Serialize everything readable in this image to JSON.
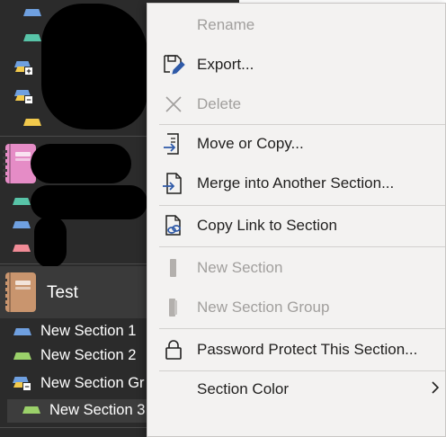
{
  "colors": {
    "nav_bg": "#2b2b2b",
    "menu_bg": "#f3f2f1",
    "icon_blue": "#2f5aa8",
    "disabled_text": "#a19f9d",
    "tab_blue": "#6fa0e0",
    "tab_teal": "#58c4a8",
    "tab_yellow": "#f2c94c",
    "tab_green": "#9bd16a",
    "tab_pink": "#f08b96",
    "notebook_pink": "#e58cc6",
    "notebook_tan": "#c9956e"
  },
  "nav": {
    "notebook_test": "Test",
    "sections": [
      {
        "label": "New Section 1",
        "color": "#6fa0e0"
      },
      {
        "label": "New Section 2",
        "color": "#9bd16a"
      }
    ],
    "section_group": "New Section Gr",
    "nested_section": "New Section 3"
  },
  "menu": {
    "items": [
      {
        "id": "rename",
        "label": "Rename",
        "icon": "none",
        "disabled": true
      },
      {
        "id": "export",
        "label": "Export...",
        "icon": "export-icon",
        "disabled": false
      },
      {
        "id": "delete",
        "label": "Delete",
        "icon": "delete-x-icon",
        "disabled": true
      },
      {
        "id": "move_copy",
        "label": "Move or Copy...",
        "icon": "move-copy-icon",
        "disabled": false
      },
      {
        "id": "merge",
        "label": "Merge into Another Section...",
        "icon": "merge-icon",
        "disabled": false
      },
      {
        "id": "copy_link",
        "label": "Copy Link to Section",
        "icon": "link-icon",
        "disabled": false
      },
      {
        "id": "new_section",
        "label": "New Section",
        "icon": "new-section-icon",
        "disabled": true
      },
      {
        "id": "new_section_group",
        "label": "New Section Group",
        "icon": "new-section-group-icon",
        "disabled": true
      },
      {
        "id": "password",
        "label": "Password Protect This Section...",
        "icon": "lock-icon",
        "disabled": false
      },
      {
        "id": "section_color",
        "label": "Section Color",
        "icon": "none",
        "disabled": false,
        "submenu": true
      }
    ]
  }
}
